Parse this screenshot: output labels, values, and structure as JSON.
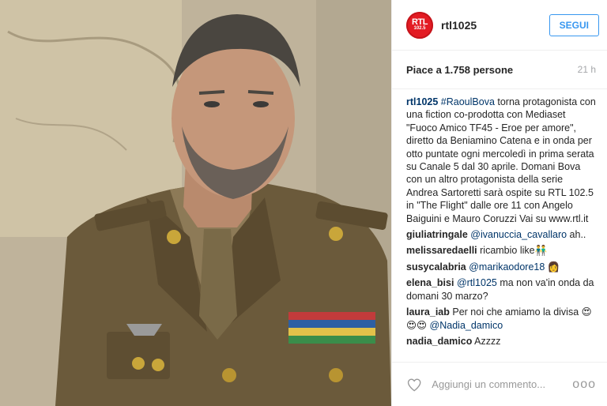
{
  "header": {
    "avatar_line1": "RTL",
    "avatar_line2": "102.5",
    "username": "rtl1025",
    "follow_label": "SEGUI"
  },
  "meta": {
    "likes": "Piace a 1.758 persone",
    "time": "21 h"
  },
  "caption": {
    "user": "rtl1025",
    "hashtag": "#RaoulBova",
    "text": " torna protagonista con una fiction co-prodotta con Mediaset \"Fuoco Amico TF45 - Eroe per amore\", diretto da Beniamino Catena e in onda per otto puntate ogni mercoledì in prima serata su Canale 5 dal 30 aprile. Domani Bova con un altro protagonista della serie Andrea Sartoretti sarà ospite su RTL 102.5 in \"The Flight\" dalle ore 11 con Angelo Baiguini e Mauro Coruzzi Vai su www.rtl.it"
  },
  "comments": [
    {
      "user": "giuliatringale",
      "mention": "@ivanuccia_cavallaro",
      "text": " ah.."
    },
    {
      "user": "melissaredaelli",
      "mention": "",
      "text": " ricambio like👬"
    },
    {
      "user": "susycalabria",
      "mention": "@marikaodore18",
      "text": " 👩"
    },
    {
      "user": "elena_bisi",
      "mention": "@rtl1025",
      "text": " ma non va'in onda da domani 30 marzo?"
    },
    {
      "user": "laura_iab",
      "mention": "",
      "text": " Per noi che amiamo la divisa 😍😍😍 ",
      "mention2": "@Nadia_damico"
    },
    {
      "user": "nadia_damico",
      "mention": "",
      "text": " Azzzz"
    }
  ],
  "footer": {
    "comment_placeholder": "Aggiungi un commento...",
    "more_label": "ooo"
  },
  "icons": {
    "heart": "heart-outline-icon",
    "more": "more-options-icon"
  },
  "colors": {
    "link": "#003569",
    "follow": "#3897f0",
    "brand": "#e31b23"
  }
}
